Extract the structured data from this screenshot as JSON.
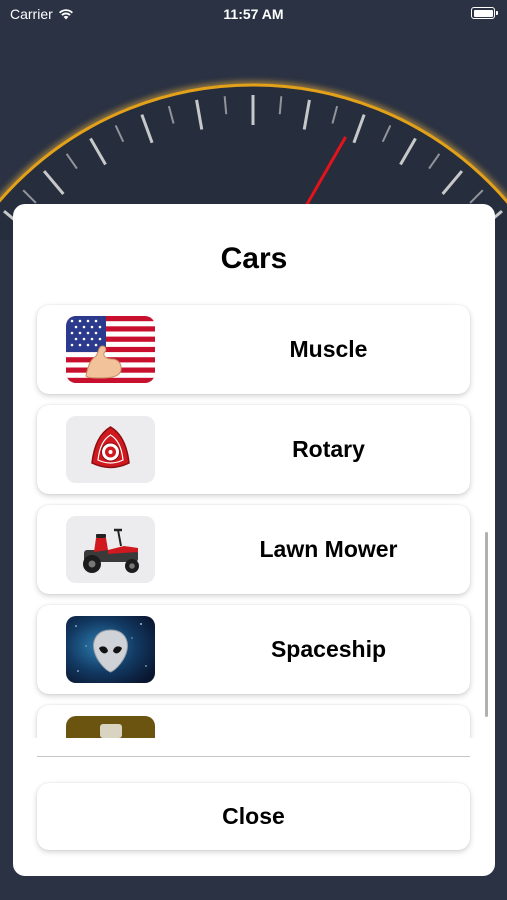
{
  "status_bar": {
    "carrier": "Carrier",
    "time": "11:57 AM",
    "wifi_icon": "wifi-icon",
    "battery_icon": "battery-icon"
  },
  "colors": {
    "background": "#2a3243",
    "gauge_rim": "#e3a11a",
    "needle": "#e3131b",
    "tick": "#d9d9d9"
  },
  "modal": {
    "title": "Cars",
    "items": [
      {
        "label": "Muscle",
        "icon": "us-flag-flexed-biceps-icon"
      },
      {
        "label": "Rotary",
        "icon": "rotary-engine-rotor-icon"
      },
      {
        "label": "Lawn Mower",
        "icon": "riding-lawn-mower-icon"
      },
      {
        "label": "Spaceship",
        "icon": "alien-face-icon"
      },
      {
        "label": "",
        "icon": "partial-item-icon"
      }
    ],
    "close_label": "Close"
  }
}
